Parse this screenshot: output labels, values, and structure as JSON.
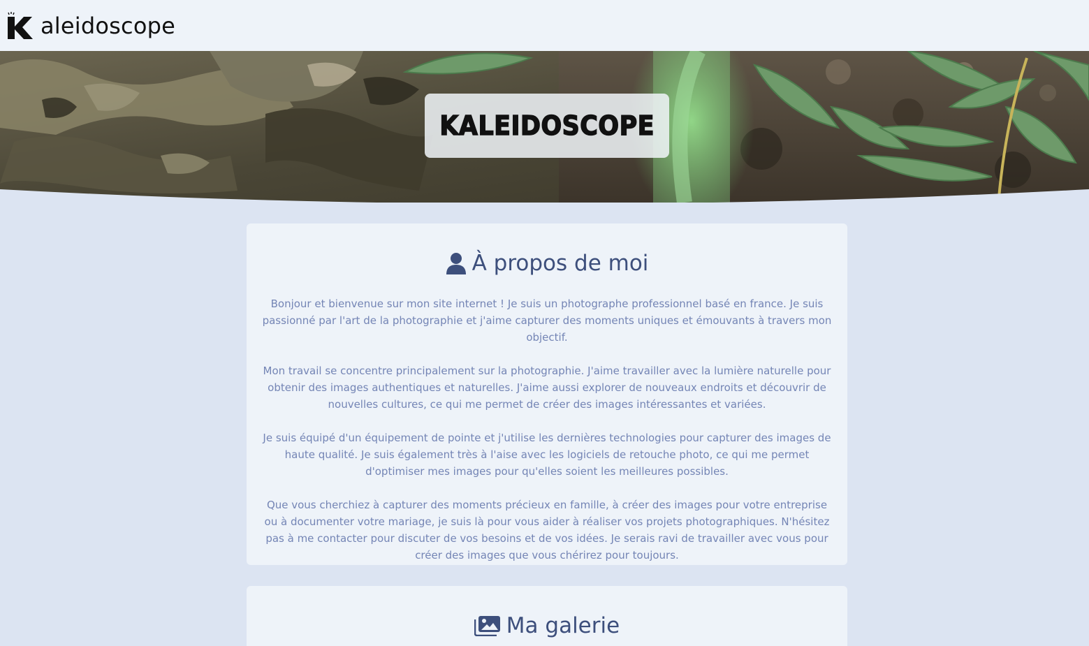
{
  "header": {
    "logo_letter": "K",
    "logo_text": "aleidoscope"
  },
  "hero": {
    "title": "KALEIDOSCOPE"
  },
  "about": {
    "icon": "user-icon",
    "heading": "À propos de moi",
    "paragraphs": [
      "Bonjour et bienvenue sur mon site internet ! Je suis un photographe professionnel basé en france. Je suis passionné par l'art de la photographie et j'aime capturer des moments uniques et émouvants à travers mon objectif.",
      "Mon travail se concentre principalement sur la photographie. J'aime travailler avec la lumière naturelle pour obtenir des images authentiques et naturelles. J'aime aussi explorer de nouveaux endroits et découvrir de nouvelles cultures, ce qui me permet de créer des images intéressantes et variées.",
      "Je suis équipé d'un équipement de pointe et j'utilise les dernières technologies pour capturer des images de haute qualité. Je suis également très à l'aise avec les logiciels de retouche photo, ce qui me permet d'optimiser mes images pour qu'elles soient les meilleures possibles.",
      "Que vous cherchiez à capturer des moments précieux en famille, à créer des images pour votre entreprise ou à documenter votre mariage, je suis là pour vous aider à réaliser vos projets photographiques. N'hésitez pas à me contacter pour discuter de vos besoins et de vos idées. Je serais ravi de travailler avec vous pour créer des images que vous chérirez pour toujours."
    ]
  },
  "gallery": {
    "icon": "images-icon",
    "heading": "Ma galerie"
  },
  "colors": {
    "page_bg": "#dce4f2",
    "card_bg": "#eef3f9",
    "heading": "#3d4f7c",
    "body_text": "#7485b5"
  }
}
